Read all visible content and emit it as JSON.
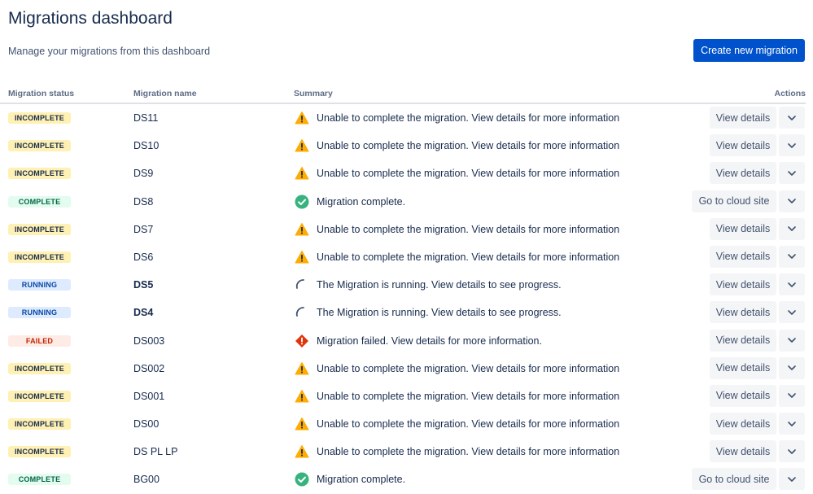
{
  "header": {
    "title": "Migrations dashboard",
    "subtitle": "Manage your migrations from this dashboard",
    "create_button": "Create new migration"
  },
  "table": {
    "columns": {
      "status": "Migration status",
      "name": "Migration name",
      "summary": "Summary",
      "actions": "Actions"
    },
    "rows": [
      {
        "status": "INCOMPLETE",
        "name": "DS11",
        "summary": "Unable to complete the migration. View details for more information",
        "action": "View details",
        "icon": "warning-icon",
        "bold": false
      },
      {
        "status": "INCOMPLETE",
        "name": "DS10",
        "summary": "Unable to complete the migration. View details for more information",
        "action": "View details",
        "icon": "warning-icon",
        "bold": false
      },
      {
        "status": "INCOMPLETE",
        "name": "DS9",
        "summary": "Unable to complete the migration. View details for more information",
        "action": "View details",
        "icon": "warning-icon",
        "bold": false
      },
      {
        "status": "COMPLETE",
        "name": "DS8",
        "summary": "Migration complete.",
        "action": "Go to cloud site",
        "icon": "check-circle-icon",
        "bold": false
      },
      {
        "status": "INCOMPLETE",
        "name": "DS7",
        "summary": "Unable to complete the migration. View details for more information",
        "action": "View details",
        "icon": "warning-icon",
        "bold": false
      },
      {
        "status": "INCOMPLETE",
        "name": "DS6",
        "summary": "Unable to complete the migration. View details for more information",
        "action": "View details",
        "icon": "warning-icon",
        "bold": false
      },
      {
        "status": "RUNNING",
        "name": "DS5",
        "summary": "The Migration is running. View details to see progress.",
        "action": "View details",
        "icon": "spinner-icon",
        "bold": true
      },
      {
        "status": "RUNNING",
        "name": "DS4",
        "summary": "The Migration is running. View details to see progress.",
        "action": "View details",
        "icon": "spinner-icon",
        "bold": true
      },
      {
        "status": "FAILED",
        "name": "DS003",
        "summary": "Migration failed. View details for more information.",
        "action": "View details",
        "icon": "error-icon",
        "bold": false
      },
      {
        "status": "INCOMPLETE",
        "name": "DS002",
        "summary": "Unable to complete the migration. View details for more information",
        "action": "View details",
        "icon": "warning-icon",
        "bold": false
      },
      {
        "status": "INCOMPLETE",
        "name": "DS001",
        "summary": "Unable to complete the migration. View details for more information",
        "action": "View details",
        "icon": "warning-icon",
        "bold": false
      },
      {
        "status": "INCOMPLETE",
        "name": "DS00",
        "summary": "Unable to complete the migration. View details for more information",
        "action": "View details",
        "icon": "warning-icon",
        "bold": false
      },
      {
        "status": "INCOMPLETE",
        "name": "DS PL LP",
        "summary": "Unable to complete the migration. View details for more information",
        "action": "View details",
        "icon": "warning-icon",
        "bold": false
      },
      {
        "status": "COMPLETE",
        "name": "BG00",
        "summary": "Migration complete.",
        "action": "Go to cloud site",
        "icon": "check-circle-icon",
        "bold": false
      }
    ]
  },
  "colors": {
    "primary": "#0052cc",
    "warning": "#ffab00",
    "success": "#36b37e",
    "danger": "#de350b"
  }
}
